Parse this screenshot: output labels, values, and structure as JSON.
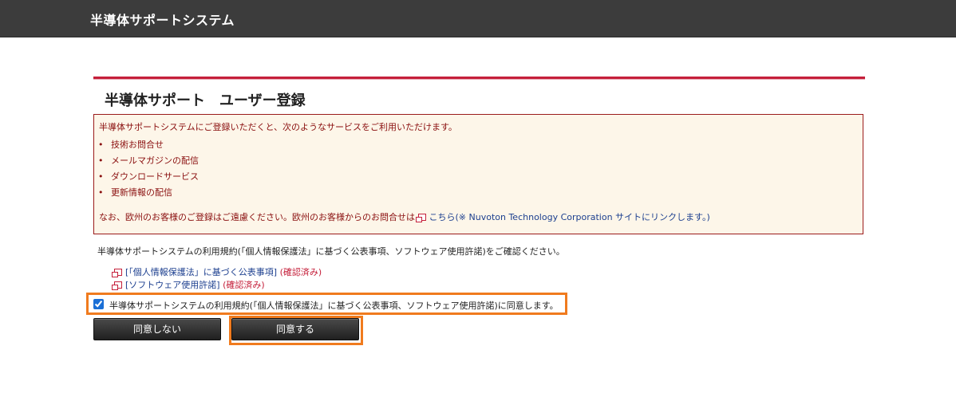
{
  "header": {
    "title": "半導体サポートシステム"
  },
  "page": {
    "title": "半導体サポート　ユーザー登録"
  },
  "notice": {
    "intro": "半導体サポートシステムにご登録いただくと、次のようなサービスをご利用いただけます。",
    "bullet": "•",
    "items": [
      "技術お問合せ",
      "メールマガジンの配信",
      "ダウンロードサービス",
      "更新情報の配信"
    ],
    "footer_prefix": "なお、欧州のお客様のご登録はご遠慮ください。欧州のお客様からのお問合せは",
    "footer_link": "こちら(※ Nuvoton Technology Corporation サイトにリンクします。)"
  },
  "terms": {
    "confirm_text": "半導体サポートシステムの利用規約(「個人情報保護法」に基づく公表事項、ソフトウェア使用許諾)をご確認ください。",
    "links": [
      {
        "label": "[「個人情報保護法」に基づく公表事項]",
        "status": "(確認済み)"
      },
      {
        "label": "[ソフトウェア使用許諾]",
        "status": "(確認済み)"
      }
    ],
    "agree_checkbox_label": "半導体サポートシステムの利用規約(「個人情報保護法」に基づく公表事項、ソフトウェア使用許諾)に同意します。",
    "agree_checked": true
  },
  "buttons": {
    "decline_label": "同意しない",
    "agree_label": "同意する"
  },
  "colors": {
    "header_bg": "#3c3c3c",
    "accent_red": "#c5203b",
    "highlight_orange": "#f07b1e",
    "link_blue": "#1c3f8f"
  }
}
